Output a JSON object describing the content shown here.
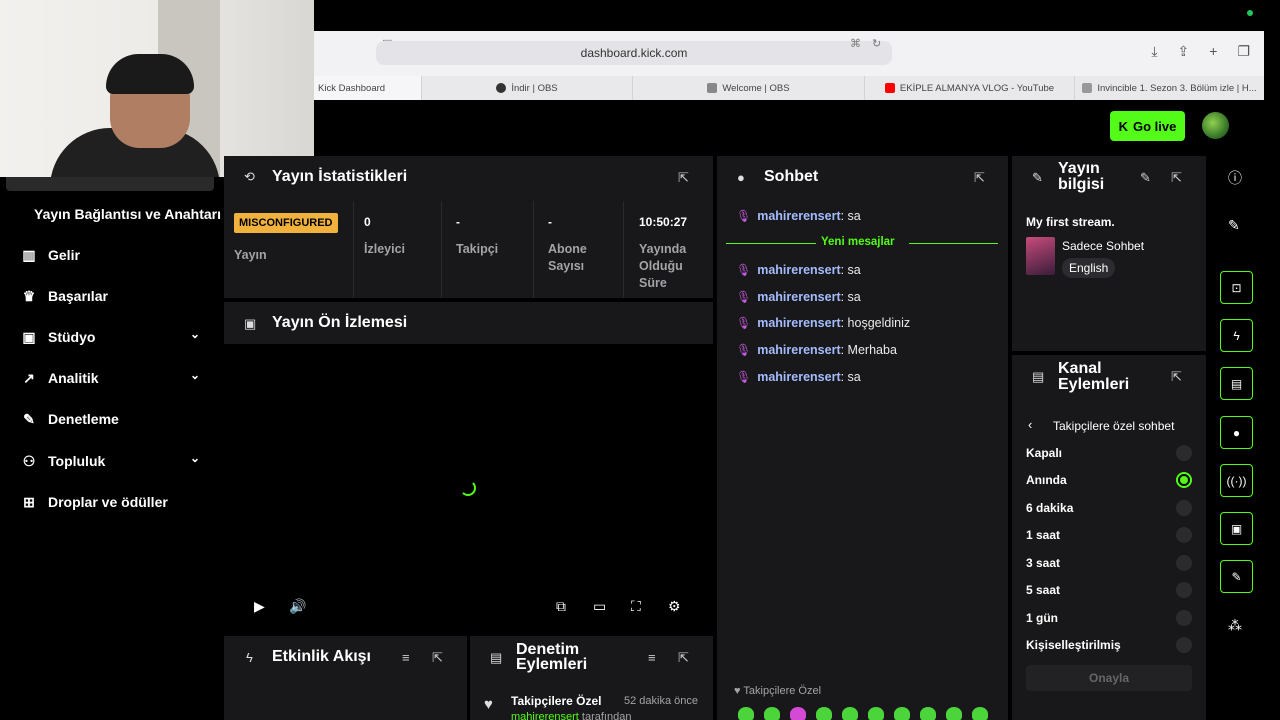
{
  "browser": {
    "url": "dashboard.kick.com",
    "tabs": [
      {
        "label": "Kick Dashboard",
        "icon": "kick-icon",
        "color": "#53fc18"
      },
      {
        "label": "İndir | OBS",
        "icon": "obs-icon",
        "color": "#333333"
      },
      {
        "label": "Welcome | OBS",
        "icon": "obs-icon",
        "color": "#888888"
      },
      {
        "label": "EKİPLE ALMANYA VLOG - YouTube",
        "icon": "youtube-icon",
        "color": "#ff0000"
      },
      {
        "label": "Invincible 1. Sezon 3. Bölüm izle | H...",
        "icon": "h-icon",
        "color": "#999999"
      }
    ]
  },
  "header": {
    "go_live": "Go live"
  },
  "sidebar": {
    "partial_item": "Yayın",
    "sub_item": "Yayın Bağlantısı ve Anahtarı",
    "items": [
      {
        "label": "Gelir",
        "icon": "chart-icon",
        "chevron": false
      },
      {
        "label": "Başarılar",
        "icon": "trophy-icon",
        "chevron": false
      },
      {
        "label": "Stüdyo",
        "icon": "studio-icon",
        "chevron": true
      },
      {
        "label": "Analitik",
        "icon": "analytics-icon",
        "chevron": true
      },
      {
        "label": "Denetleme",
        "icon": "wrench-icon",
        "chevron": false
      },
      {
        "label": "Topluluk",
        "icon": "community-icon",
        "chevron": true
      },
      {
        "label": "Droplar ve ödüller",
        "icon": "drops-icon",
        "chevron": false
      }
    ]
  },
  "stats": {
    "title": "Yayın İstatistikleri",
    "status_badge": "MISCONFIGURED",
    "stream_label": "Yayın",
    "viewers_value": "0",
    "viewers_label": "İzleyici",
    "followers_value": "-",
    "followers_label": "Takipçi",
    "subs_value": "-",
    "subs_label": "Abone Sayısı",
    "uptime_value": "10:50:27",
    "uptime_label": "Yayında Olduğu Süre"
  },
  "preview": {
    "title": "Yayın Ön İzlemesi"
  },
  "activity": {
    "title": "Etkinlik Akışı"
  },
  "moderation": {
    "title": "Denetim Eylemleri",
    "entry_title": "Takipçilere Özel",
    "entry_time": "52 dakika önce",
    "entry_user": "mahirerensert",
    "entry_suffix": "tarafından"
  },
  "chat": {
    "title": "Sohbet",
    "new_messages": "Yeni mesajlar",
    "messages": [
      {
        "user": "mahirerensert",
        "text": ": sa"
      },
      {
        "user": "mahirerensert",
        "text": ": sa"
      },
      {
        "user": "mahirerensert",
        "text": ": sa"
      },
      {
        "user": "mahirerensert",
        "text": ": hoşgeldiniz"
      },
      {
        "user": "mahirerensert",
        "text": ": Merhaba"
      },
      {
        "user": "mahirerensert",
        "text": ": sa"
      }
    ],
    "mode_label": "Takipçilere Özel"
  },
  "stream_info": {
    "title": "Yayın bilgisi",
    "stream_title": "My first stream.",
    "category": "Sadece Sohbet",
    "language": "English"
  },
  "channel_actions": {
    "title": "Kanal Eylemleri",
    "submenu": "Takipçilere özel sohbet",
    "options": [
      "Kapalı",
      "Anında",
      "6 dakika",
      "1 saat",
      "3 saat",
      "5 saat",
      "1 gün",
      "Kişiselleştirilmiş"
    ],
    "selected": "Anında",
    "confirm": "Onayla"
  },
  "colors": {
    "accent": "#53fc18",
    "badge": "#f0b23c",
    "username": "#a4bcff"
  }
}
